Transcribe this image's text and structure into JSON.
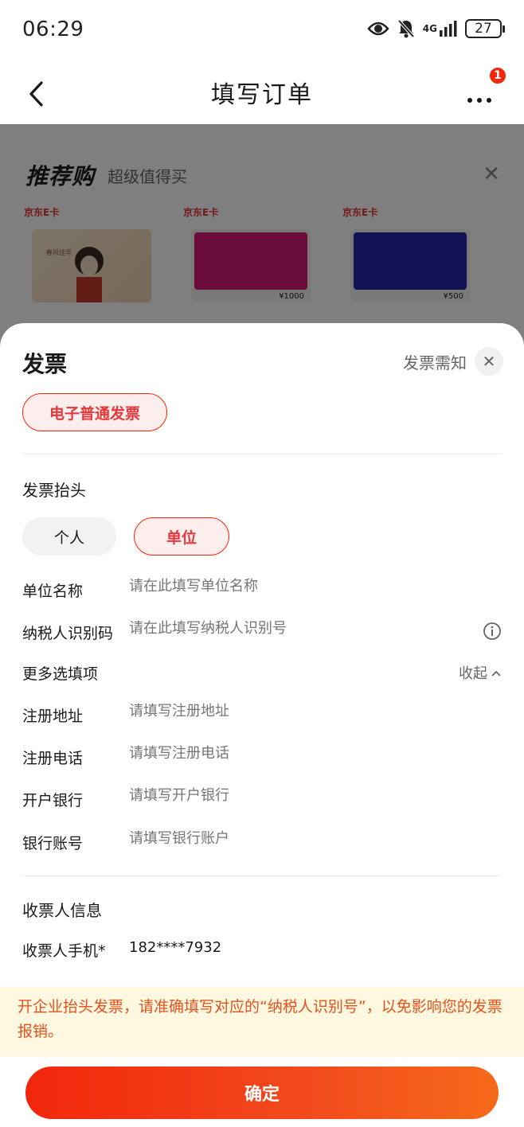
{
  "status_bar": {
    "time": "06:29",
    "network": "4G",
    "battery": "27",
    "icons": [
      "eye-icon",
      "mute-bell-icon",
      "signal-icon",
      "battery-icon"
    ]
  },
  "nav": {
    "title": "填写订单",
    "badge_count": "1",
    "icons": [
      "back-arrow-icon",
      "more-dots-icon"
    ]
  },
  "recommend": {
    "logo": "推荐购",
    "subtitle": "超级值得买",
    "products": [
      {
        "tag": "京东E卡",
        "price": ""
      },
      {
        "tag": "京东E卡",
        "price": "¥1000"
      },
      {
        "tag": "京东E卡",
        "price": "¥500"
      }
    ]
  },
  "invoice": {
    "title": "发票",
    "notice_link": "发票需知",
    "type_chip": "电子普通发票",
    "header_section": "发票抬头",
    "header_options": [
      "个人",
      "单位"
    ],
    "selected_header": "单位",
    "fields": {
      "company_name": {
        "label": "单位名称",
        "placeholder": "请在此填写单位名称"
      },
      "tax_id": {
        "label": "纳税人识别码",
        "placeholder": "请在此填写纳税人识别号"
      },
      "more_options": {
        "label": "更多选填项",
        "toggle": "收起"
      },
      "reg_address": {
        "label": "注册地址",
        "placeholder": "请填写注册地址"
      },
      "reg_phone": {
        "label": "注册电话",
        "placeholder": "请填写注册电话"
      },
      "bank": {
        "label": "开户银行",
        "placeholder": "请填写开户银行"
      },
      "bank_account": {
        "label": "银行账号",
        "placeholder": "请填写银行账户"
      }
    },
    "recipient_section": "收票人信息",
    "recipient_phone": {
      "label": "收票人手机*",
      "value": "182****7932"
    },
    "warning": "开企业抬头发票，请准确填写对应的“纳税人识别号”，以免影响您的发票报销。",
    "confirm_label": "确定"
  },
  "colors": {
    "accent": "#f2270c",
    "chip_bg": "#fdeeee",
    "warning_bg": "#fff8e1",
    "warning_text": "#e6501a"
  }
}
